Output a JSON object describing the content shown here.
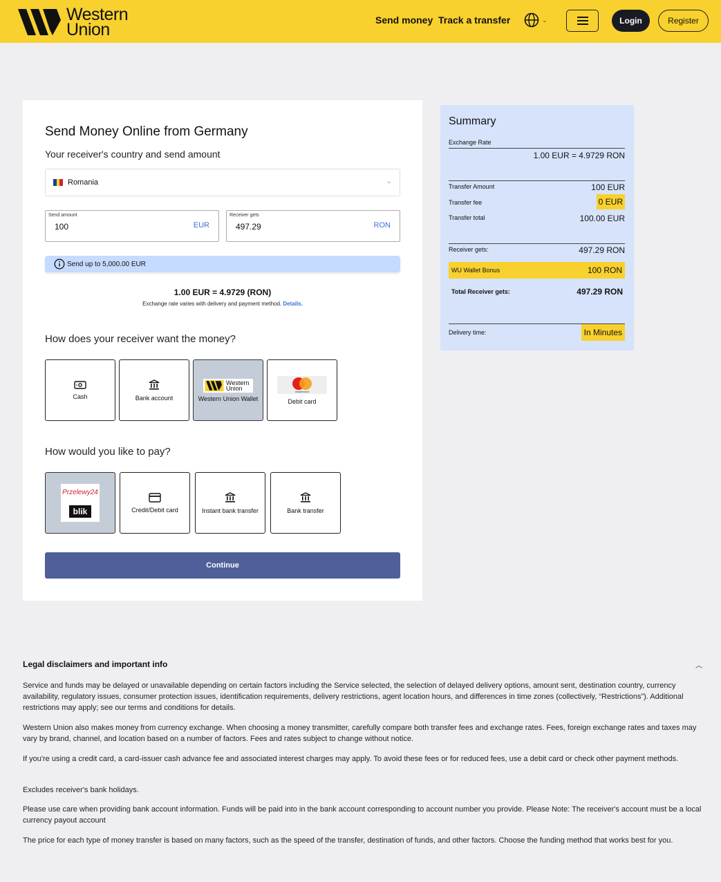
{
  "header": {
    "brand_line1": "Western",
    "brand_line2": "Union",
    "nav": [
      "Send money",
      "Track a transfer"
    ],
    "login": "Login",
    "register": "Register"
  },
  "form": {
    "title": "Send Money Online from Germany",
    "subtitle": "Your receiver's country and send amount",
    "country": "Romania",
    "send_label": "Send amount",
    "send_value": "100",
    "send_currency": "EUR",
    "receive_label": "Receiver gets",
    "receive_value": "497.29",
    "receive_currency": "RON",
    "limit_note": "Send up to 5,000.00 EUR",
    "rate": "1.00 EUR = 4.9729 (RON)",
    "rate_note": "Exchange rate varies with delivery and payment method.",
    "rate_link": "Details.",
    "receive_title": "How does your receiver want the money?",
    "receive_options": [
      {
        "label": "Cash",
        "selected": false
      },
      {
        "label": "Bank account",
        "selected": false
      },
      {
        "label": "Western Union Wallet",
        "selected": true
      },
      {
        "label": "Debit card",
        "selected": false
      }
    ],
    "wallet_logo_line1": "Western",
    "wallet_logo_line2": "Union",
    "mastercard_text": "mastercard",
    "pay_title": "How would you like to pay?",
    "pay_options": [
      {
        "label": "",
        "selected": true
      },
      {
        "label": "Credit/Debit card",
        "selected": false
      },
      {
        "label": "Instant bank transfer",
        "selected": false
      },
      {
        "label": "Bank transfer",
        "selected": false
      }
    ],
    "p24_text": "Przelewy24",
    "blik_text": "blik",
    "continue": "Continue"
  },
  "summary": {
    "title": "Summary",
    "exchange_rate_label": "Exchange Rate",
    "exchange_rate_value": "1.00 EUR = 4.9729 RON",
    "transfer_amount_label": "Transfer Amount",
    "transfer_amount_value": "100 EUR",
    "transfer_fee_label": "Transfer fee",
    "transfer_fee_value": "0 EUR",
    "transfer_total_label": "Transfer total",
    "transfer_total_value": "100.00 EUR",
    "receiver_gets_label": "Receiver gets:",
    "receiver_gets_value": "497.29 RON",
    "bonus_label": "WU Wallet Bonus",
    "bonus_value": "100 RON",
    "total_label": "Total Receiver gets:",
    "total_value": "497.29 RON",
    "delivery_label": "Delivery time:",
    "delivery_value": "In Minutes"
  },
  "legal": {
    "title": "Legal disclaimers and important info",
    "paragraphs": [
      "Service and funds may be delayed or unavailable depending on certain factors including the Service selected, the selection of delayed delivery options, amount sent, destination country, currency availability, regulatory issues, consumer protection issues, identification requirements, delivery restrictions, agent location hours, and differences in time zones (collectively, “Restrictions”). Additional restrictions may apply; see our terms and conditions for details.",
      "Western Union also makes money from currency exchange. When choosing a money transmitter, carefully compare both transfer fees and exchange rates. Fees, foreign exchange rates and taxes may vary by brand, channel, and location based on a number of factors. Fees and rates subject to change without notice.",
      "If you're using a credit card, a card-issuer cash advance fee and associated interest charges may apply. To avoid these fees or for reduced fees, use a debit card or check other payment methods.",
      "Excludes receiver's bank holidays.",
      "Please use care when providing bank account information. Funds will be paid into in the bank account corresponding to account number you provide. Please Note: The receiver's account must be a local currency payout account",
      "The price for each type of money transfer is based on many factors, such as the speed of the transfer, destination of funds, and other factors. Choose the funding method that works best for you."
    ]
  },
  "colors": {
    "brand_yellow": "#f8d12e",
    "summary_bg": "#d6e3fb",
    "continue_bg": "#4f5f9a",
    "link_blue": "#3b6fd9"
  }
}
